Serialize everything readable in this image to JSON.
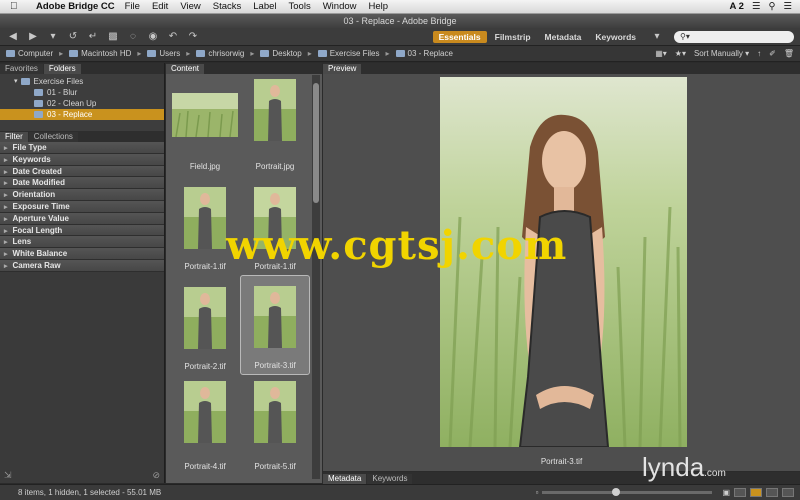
{
  "menubar": {
    "app_name": "Adobe Bridge CC",
    "items": [
      "File",
      "Edit",
      "View",
      "Stacks",
      "Label",
      "Tools",
      "Window",
      "Help"
    ],
    "right_text": "A 2"
  },
  "window_title": "03 - Replace - Adobe Bridge",
  "workspaces": {
    "items": [
      "Essentials",
      "Filmstrip",
      "Metadata",
      "Keywords"
    ],
    "active": "Essentials"
  },
  "path": {
    "crumbs": [
      "Computer",
      "Macintosh HD",
      "Users",
      "chrisorwig",
      "Desktop",
      "Exercise Files",
      "03 - Replace"
    ],
    "sort_label": "Sort Manually"
  },
  "left_tabs": [
    "Favorites",
    "Folders"
  ],
  "folders": [
    {
      "label": "Exercise Files",
      "level": 1,
      "selected": false
    },
    {
      "label": "01 - Blur",
      "level": 2,
      "selected": false
    },
    {
      "label": "02 - Clean Up",
      "level": 2,
      "selected": false
    },
    {
      "label": "03 - Replace",
      "level": 2,
      "selected": true
    }
  ],
  "filter_tabs": [
    "Filter",
    "Collections"
  ],
  "filters": [
    "File Type",
    "Keywords",
    "Date Created",
    "Date Modified",
    "Orientation",
    "Exposure Time",
    "Aperture Value",
    "Focal Length",
    "Lens",
    "White Balance",
    "Camera Raw"
  ],
  "content_tab": "Content",
  "thumbnails": [
    {
      "name": "Field.jpg",
      "wide": true,
      "selected": false
    },
    {
      "name": "Portrait.jpg",
      "wide": false,
      "selected": false
    },
    {
      "name": "Portrait-1.tif",
      "wide": false,
      "selected": false
    },
    {
      "name": "Portrait-1.tif",
      "wide": false,
      "selected": false
    },
    {
      "name": "Portrait-2.tif",
      "wide": false,
      "selected": false
    },
    {
      "name": "Portrait-3.tif",
      "wide": false,
      "selected": true
    },
    {
      "name": "Portrait-4.tif",
      "wide": false,
      "selected": false
    },
    {
      "name": "Portrait-5.tif",
      "wide": false,
      "selected": false
    }
  ],
  "preview_tab": "Preview",
  "preview_caption": "Portrait-3.tif",
  "bottom_tabs": [
    "Metadata",
    "Keywords"
  ],
  "status": "8 items, 1 hidden, 1 selected - 55.01 MB",
  "watermarks": {
    "site": "www.cgtsj.com",
    "brand": "lynda",
    "brand_suffix": ".com"
  },
  "colors": {
    "accent": "#c9921e",
    "watermark": "#f1d400"
  }
}
